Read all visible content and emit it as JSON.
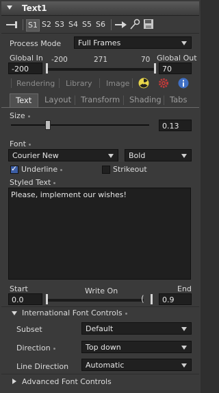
{
  "title": "Text1",
  "toolbar": {
    "slots": [
      "S1",
      "S2",
      "S3",
      "S4",
      "S5",
      "S6"
    ]
  },
  "process_mode": {
    "label": "Process Mode",
    "value": "Full Frames"
  },
  "range": {
    "global_in_label": "Global In",
    "global_out_label": "Global Out",
    "global_in_value": "-200",
    "global_out_value": "70",
    "mark_left": "-200",
    "mark_mid": "271",
    "mark_right": "70"
  },
  "main_tabs": [
    "Rendering",
    "Library",
    "Image"
  ],
  "sub_tabs": [
    "Text",
    "Layout",
    "Transform",
    "Shading",
    "Tabs"
  ],
  "size": {
    "label": "Size",
    "value": "0.13",
    "fraction": 0.13
  },
  "font": {
    "label": "Font",
    "family": "Courier New",
    "style": "Bold"
  },
  "underline": {
    "label": "Underline",
    "checked": true
  },
  "strikeout": {
    "label": "Strikeout",
    "checked": false
  },
  "styled_text": {
    "label": "Styled Text",
    "value": "Please, implement our wishes!"
  },
  "write_on": {
    "label": "Write On",
    "start_label": "Start",
    "end_label": "End",
    "start_value": "0.0",
    "end_value": "0.9"
  },
  "intl": {
    "header": "International Font Controls",
    "subset_label": "Subset",
    "subset_value": "Default",
    "direction_label": "Direction",
    "direction_value": "Top down",
    "line_direction_label": "Line Direction",
    "line_direction_value": "Automatic"
  },
  "advanced": {
    "header": "Advanced Font Controls"
  },
  "colors": {
    "panel": "#3a3a3a",
    "field": "#1f1f1f",
    "accent": "#3c5ea5"
  }
}
